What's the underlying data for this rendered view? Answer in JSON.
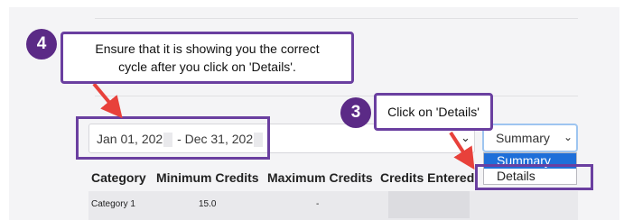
{
  "callouts": {
    "step4": {
      "number": "4",
      "line1": "Ensure that it is showing you the correct",
      "line2": "cycle after you click on 'Details'."
    },
    "step3": {
      "number": "3",
      "text": "Click on 'Details'"
    }
  },
  "filter": {
    "start": "Jan 01, 202",
    "end": "- Dec 31, 202"
  },
  "view_select": {
    "value": "Summary",
    "options": [
      "Summary",
      "Details"
    ]
  },
  "table": {
    "headers": [
      "Category",
      "Minimum Credits",
      "Maximum Credits",
      "Credits Entered"
    ],
    "rows": [
      {
        "category": "Category 1",
        "minimum": "15.0",
        "maximum": "-"
      }
    ]
  },
  "colors": {
    "callout_border": "#6a3fa0",
    "badge": "#5b2a86",
    "arrow": "#e8413b",
    "selected_option": "#1e6fd9"
  },
  "icons": {
    "chevron": "chevron-down-icon",
    "arrow": "red-arrow-icon"
  }
}
